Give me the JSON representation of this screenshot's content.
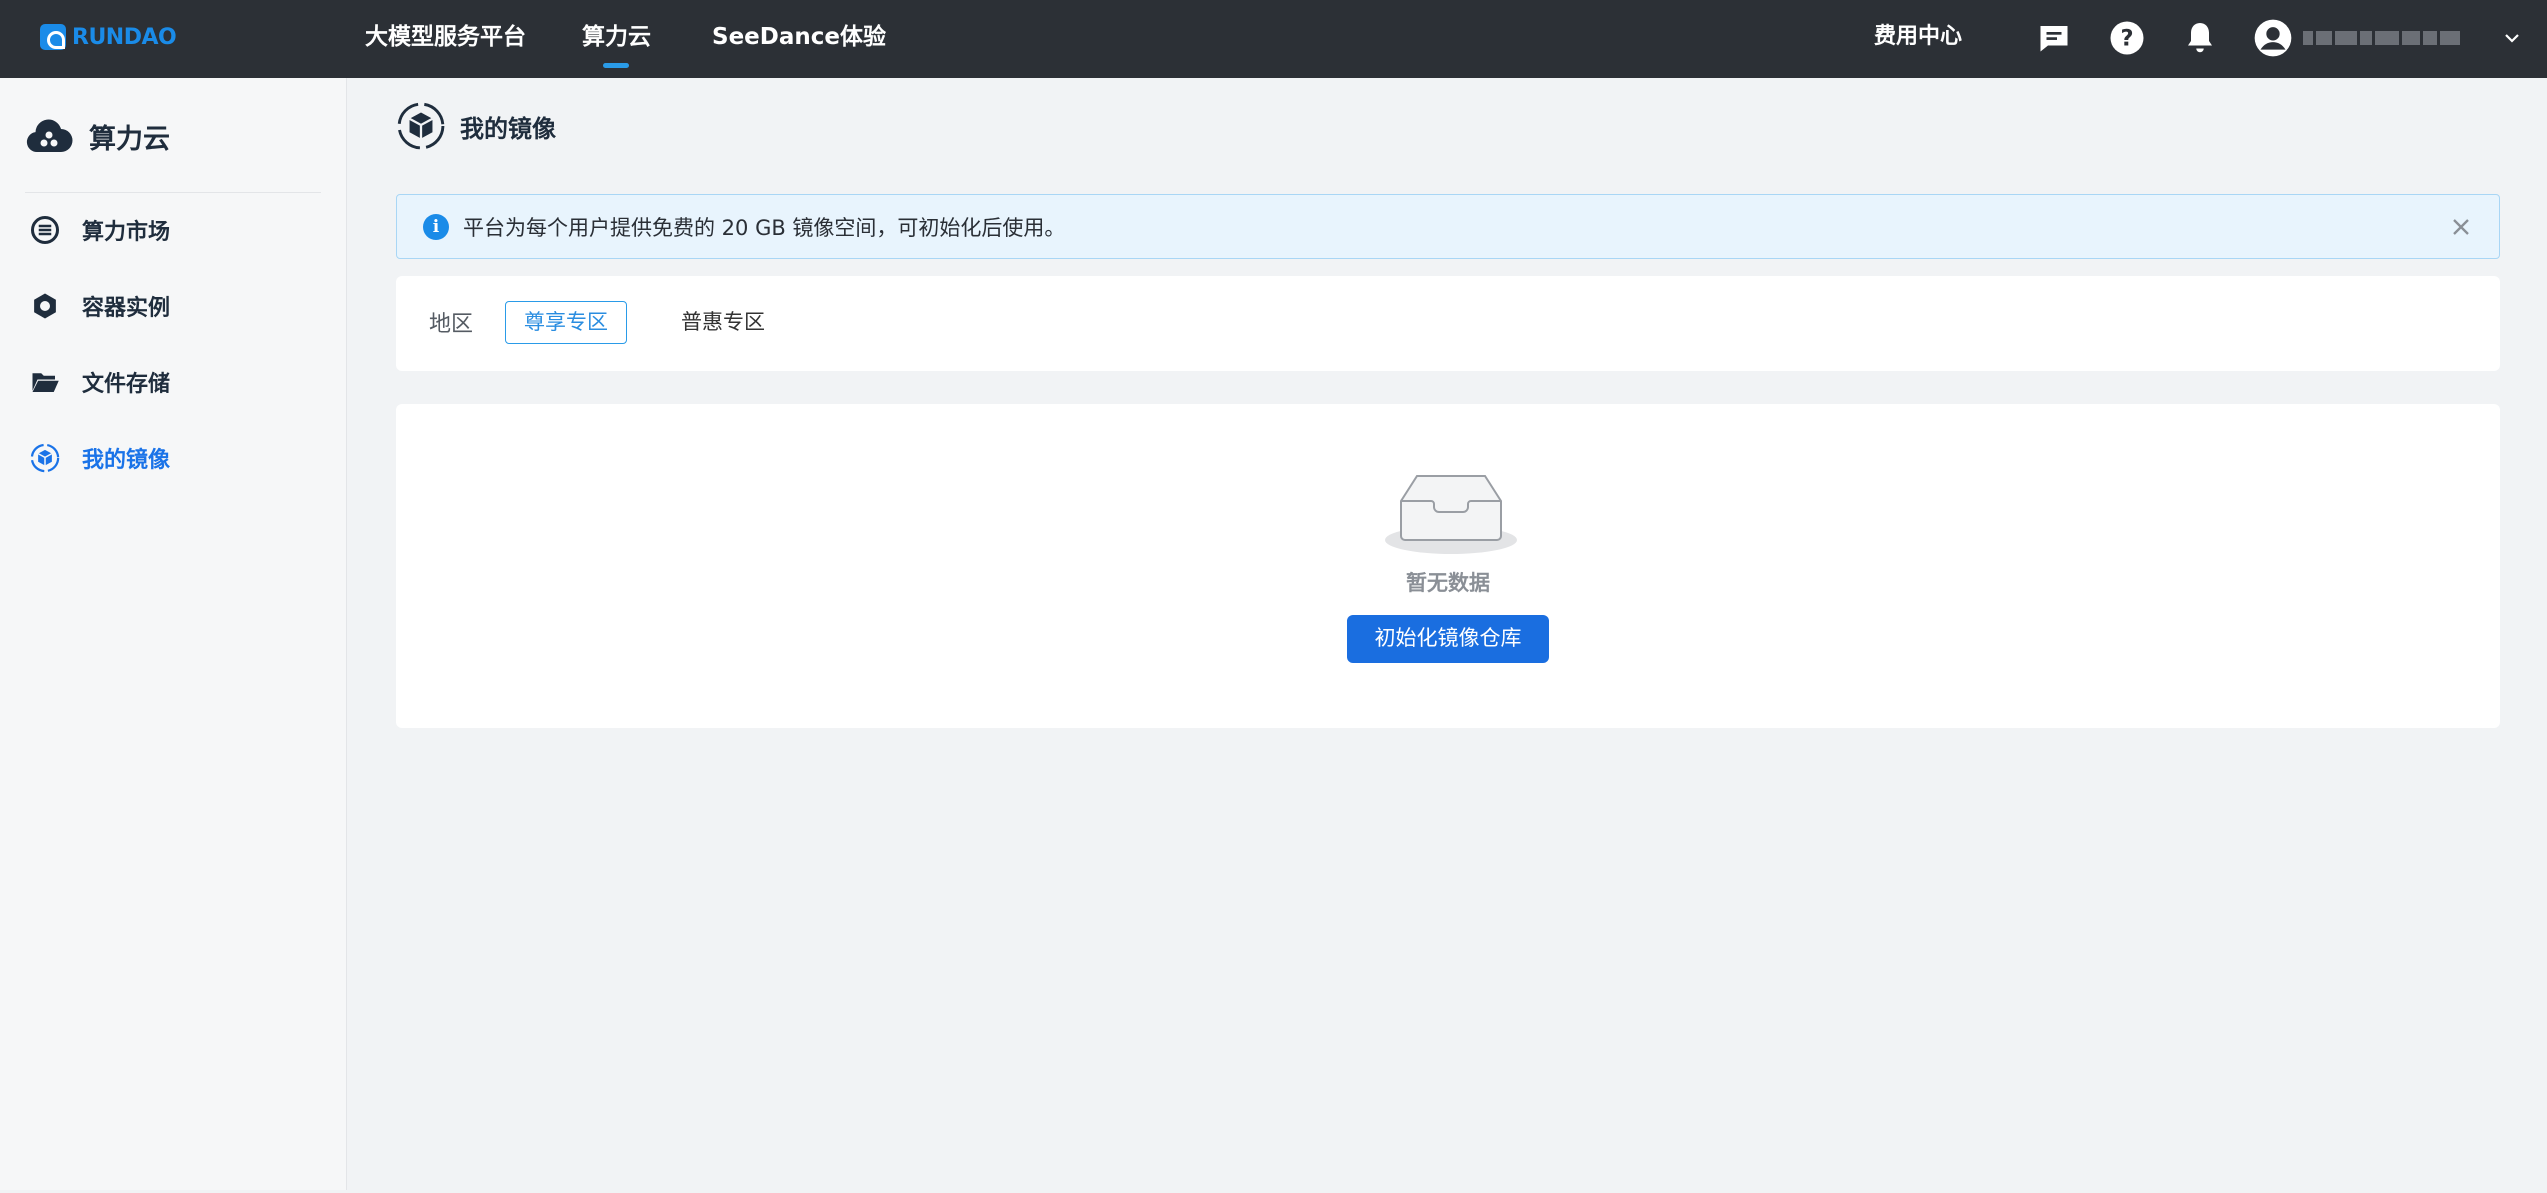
{
  "app": {
    "logo_text": "RUNDAO",
    "brand_color": "#1a8be8",
    "accent_color": "#1a6ee0"
  },
  "topnav": {
    "items": [
      {
        "label": "大模型服务平台"
      },
      {
        "label": "算力云",
        "active": true
      },
      {
        "label": "SeeDance体验"
      }
    ],
    "fee_center": "费用中心",
    "icons": [
      "message-icon",
      "help-icon",
      "bell-icon",
      "user-avatar-icon",
      "chevron-down-icon"
    ]
  },
  "sidebar": {
    "title": "算力云",
    "items": [
      {
        "label": "算力市场",
        "icon": "list-icon"
      },
      {
        "label": "容器实例",
        "icon": "hexagon-icon"
      },
      {
        "label": "文件存储",
        "icon": "folder-open-icon"
      },
      {
        "label": "我的镜像",
        "icon": "image-cube-icon",
        "active": true
      }
    ]
  },
  "main": {
    "page_title": "我的镜像",
    "alert": {
      "text": "平台为每个用户提供免费的 20 GB 镜像空间，可初始化后使用。"
    },
    "region_filter": {
      "label": "地区",
      "options": [
        {
          "label": "尊享专区",
          "selected": true
        },
        {
          "label": "普惠专区",
          "selected": false
        }
      ]
    },
    "empty_state": {
      "text": "暂无数据",
      "button_label": "初始化镜像仓库"
    }
  }
}
